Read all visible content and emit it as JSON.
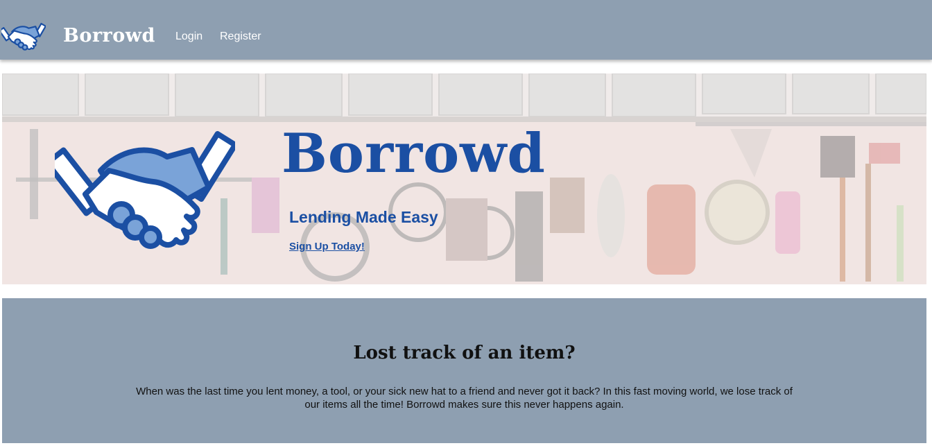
{
  "navbar": {
    "logo_icon": "handshake-icon",
    "brand": "Borrowd",
    "links": [
      {
        "label": "Login"
      },
      {
        "label": "Register"
      }
    ]
  },
  "hero": {
    "background": "garage-storage-photo",
    "logo_icon": "handshake-icon",
    "title": "Borrowd",
    "tagline": "Lending Made Easy",
    "cta": "Sign Up Today!"
  },
  "info": {
    "heading": "Lost track of an item?",
    "body": "When was the last time you lent money, a tool, or your sick new hat to a friend and never got it back? In this fast moving world, we lose track of our items all the time! Borrowd makes sure this never happens again."
  },
  "colors": {
    "navbar": "#8e9fb1",
    "brand_blue": "#1b4fa3",
    "accent_light_blue": "#7aa3d8",
    "text_dark": "#111111"
  }
}
